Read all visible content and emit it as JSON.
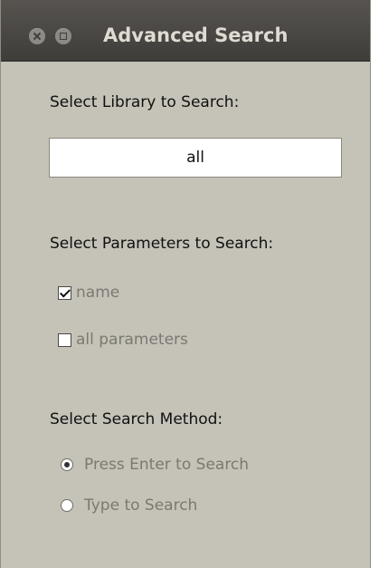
{
  "window": {
    "title": "Advanced Search"
  },
  "library": {
    "heading": "Select Library to Search:",
    "value": "all"
  },
  "parameters": {
    "heading": "Select Parameters to Search:",
    "options": [
      {
        "label": "name",
        "checked": true
      },
      {
        "label": "all parameters",
        "checked": false
      }
    ]
  },
  "method": {
    "heading": "Select Search Method:",
    "options": [
      {
        "label": "Press Enter to Search",
        "selected": true
      },
      {
        "label": "Type to Search",
        "selected": false
      }
    ]
  }
}
